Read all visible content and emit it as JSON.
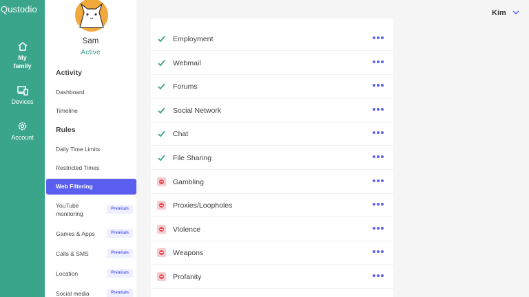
{
  "app": {
    "brand": "Qustodio"
  },
  "rail": {
    "items": [
      {
        "label": "My family",
        "icon": "home-icon"
      },
      {
        "label": "Devices",
        "icon": "devices-icon"
      },
      {
        "label": "Account",
        "icon": "gear-icon"
      }
    ]
  },
  "child": {
    "name": "Sam",
    "status": "Active"
  },
  "nav": {
    "activity_heading": "Activity",
    "activity_items": [
      "Dashboard",
      "Timeline"
    ],
    "rules_heading": "Rules",
    "rules_items": [
      "Daily Time Limits",
      "Restricted Times",
      "Web Filtering",
      "YouTube monitoring",
      "Games & Apps",
      "Calls & SMS",
      "Location",
      "Social media"
    ],
    "active_item": "Web Filtering",
    "premium_badge": "Premium"
  },
  "header": {
    "user_name": "Kim"
  },
  "categories": [
    {
      "name": "Employment",
      "status": "allowed"
    },
    {
      "name": "Webmail",
      "status": "allowed"
    },
    {
      "name": "Forums",
      "status": "allowed"
    },
    {
      "name": "Social Network",
      "status": "allowed"
    },
    {
      "name": "Chat",
      "status": "allowed"
    },
    {
      "name": "File Sharing",
      "status": "allowed"
    },
    {
      "name": "Gambling",
      "status": "blocked"
    },
    {
      "name": "Proxies/Loopholes",
      "status": "blocked"
    },
    {
      "name": "Violence",
      "status": "blocked"
    },
    {
      "name": "Weapons",
      "status": "blocked"
    },
    {
      "name": "Profanity",
      "status": "blocked"
    }
  ],
  "colors": {
    "brand_green": "#3aa58a",
    "accent": "#5b5ff0",
    "allowed": "#3aa58a",
    "blocked": "#e74d5a"
  }
}
